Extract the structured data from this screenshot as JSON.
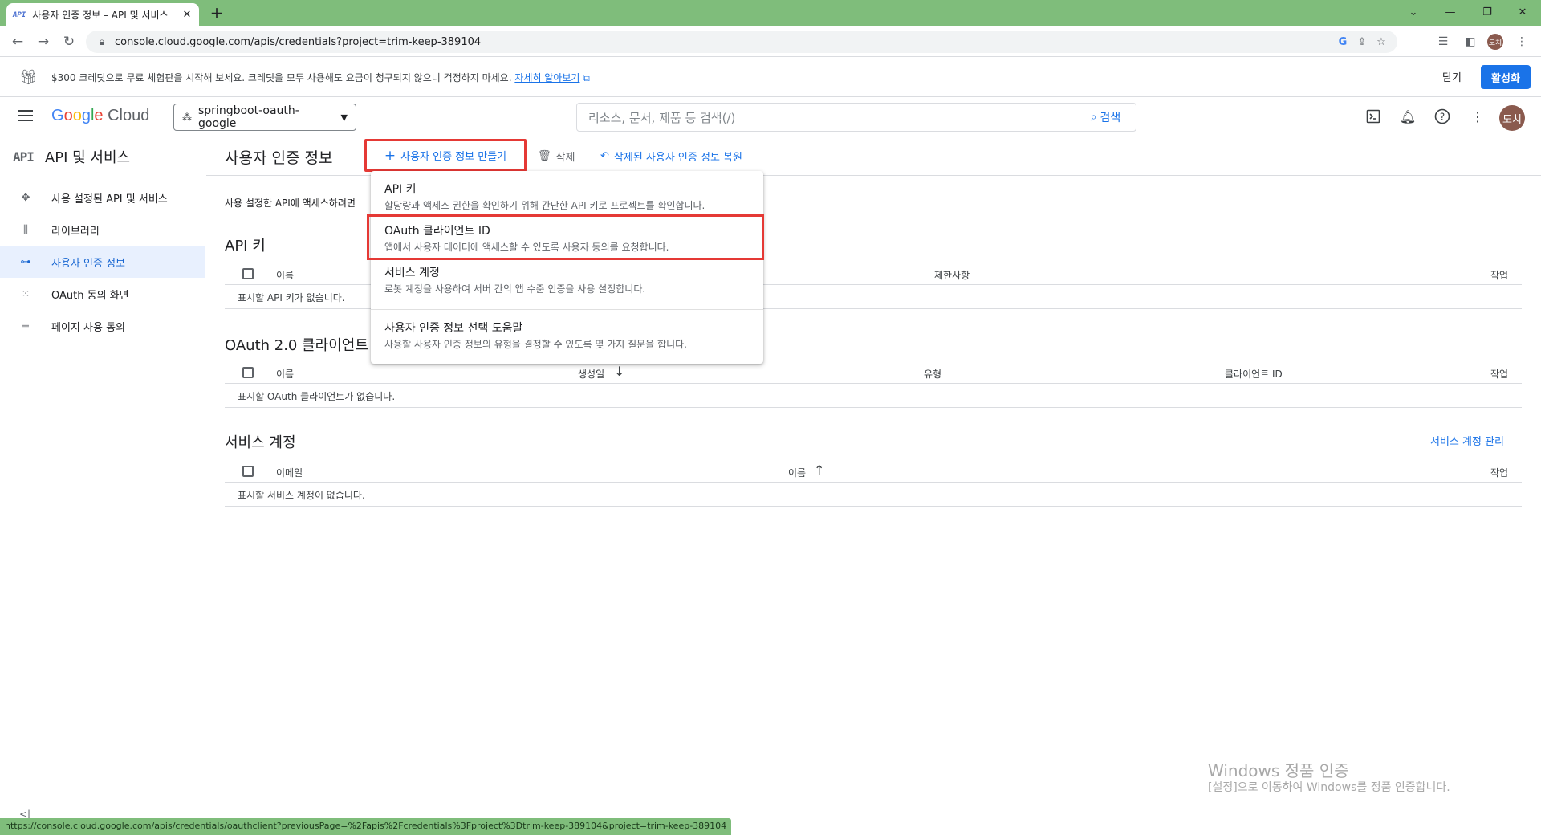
{
  "browser": {
    "tab_title": "사용자 인증 정보 – API 및 서비스",
    "tab_favicon": "API",
    "url": "console.cloud.google.com/apis/credentials?project=trim-keep-389104",
    "profile_initial": "도치"
  },
  "banner": {
    "message": "$300 크레딧으로 무료 체험판을 시작해 보세요. 크레딧을 모두 사용해도 요금이 청구되지 않으니 걱정하지 마세요.",
    "learn_more": "자세히 알아보기",
    "close_label": "닫기",
    "activate_label": "활성화"
  },
  "header": {
    "logo": {
      "g": "G",
      "o1": "o",
      "o2": "o",
      "g2": "g",
      "l": "l",
      "e": "e",
      "cloud": "Cloud"
    },
    "project": "springboot-oauth-google",
    "search_placeholder": "리소스, 문서, 제품 등 검색(/)",
    "search_button": "검색",
    "avatar_initial": "도치"
  },
  "sidebar": {
    "logo": "API",
    "title": "API 및 서비스",
    "items": [
      {
        "label": "사용 설정된 API 및 서비스",
        "icon": "diamond-arrows-icon"
      },
      {
        "label": "라이브러리",
        "icon": "library-icon"
      },
      {
        "label": "사용자 인증 정보",
        "icon": "key-icon"
      },
      {
        "label": "OAuth 동의 화면",
        "icon": "consent-grid-icon"
      },
      {
        "label": "페이지 사용 동의",
        "icon": "settings-list-icon"
      }
    ],
    "collapse_glyph": "<|"
  },
  "page": {
    "title": "사용자 인증 정보",
    "create_label": "사용자 인증 정보 만들기",
    "delete_label": "삭제",
    "restore_label": "삭제된 사용자 인증 정보 복원",
    "description": "사용 설정한 API에 액세스하려면"
  },
  "sections": {
    "api_keys": {
      "title": "API 키",
      "columns": [
        "이름",
        "제한사항",
        "작업"
      ],
      "empty": "표시할 API 키가 없습니다."
    },
    "oauth": {
      "title": "OAuth 2.0 클라이언트 ID",
      "columns": [
        "이름",
        "생성일",
        "유형",
        "클라이언트 ID",
        "작업"
      ],
      "empty": "표시할 OAuth 클라이언트가 없습니다."
    },
    "service_accounts": {
      "title": "서비스 계정",
      "manage_link": "서비스 계정 관리",
      "columns": [
        "이메일",
        "이름",
        "작업"
      ],
      "empty": "표시할 서비스 계정이 없습니다."
    }
  },
  "menu": {
    "items": [
      {
        "title": "API 키",
        "desc": "할당량과 액세스 권한을 확인하기 위해 간단한 API 키로 프로젝트를 확인합니다."
      },
      {
        "title": "OAuth 클라이언트 ID",
        "desc": "앱에서 사용자 데이터에 액세스할 수 있도록 사용자 동의를 요청합니다."
      },
      {
        "title": "서비스 계정",
        "desc": "로봇 계정을 사용하여 서버 간의 앱 수준 인증을 사용 설정합니다."
      },
      {
        "title": "사용자 인증 정보 선택 도움말",
        "desc": "사용할 사용자 인증 정보의 유형을 결정할 수 있도록 몇 가지 질문을 합니다."
      }
    ]
  },
  "watermark": {
    "line1": "Windows 정품 인증",
    "line2": "[설정]으로 이동하여 Windows를 정품 인증합니다."
  },
  "status_url": "https://console.cloud.google.com/apis/credentials/oauthclient?previousPage=%2Fapis%2Fcredentials%3Fproject%3Dtrim-keep-389104&project=trim-keep-389104",
  "colors": {
    "accent": "#1a73e8",
    "highlight": "#e53935",
    "chrome_frame": "#7fbd7b"
  }
}
